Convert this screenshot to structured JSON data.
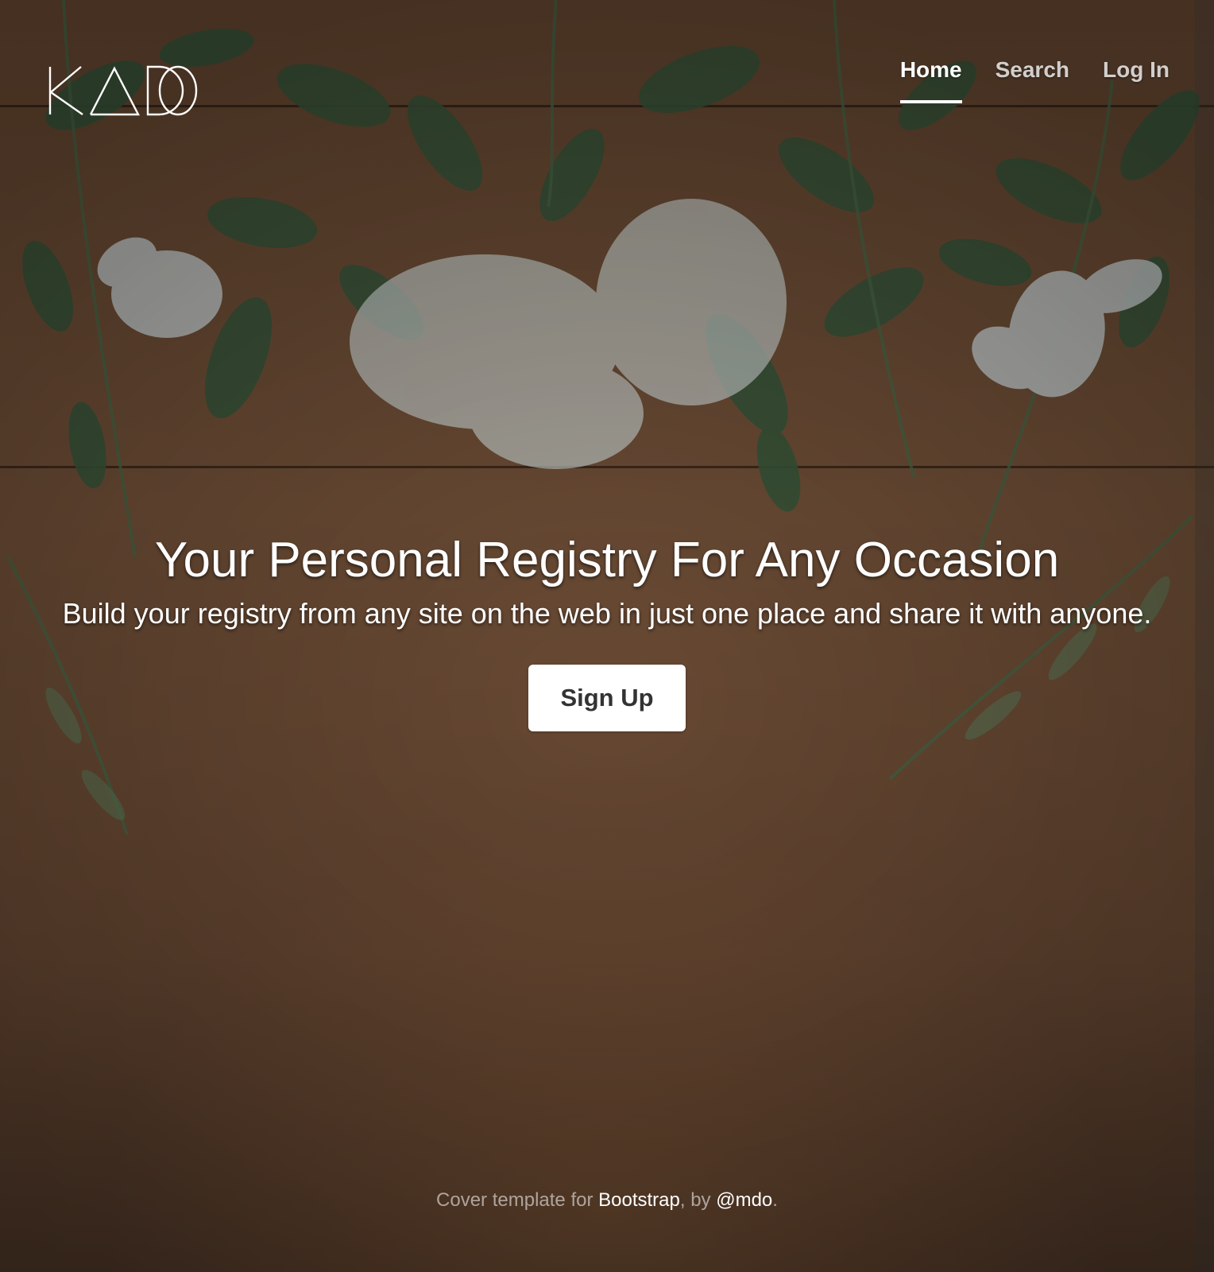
{
  "brand": {
    "logo_text": "KADO"
  },
  "nav": {
    "items": [
      {
        "label": "Home",
        "active": true
      },
      {
        "label": "Search",
        "active": false
      },
      {
        "label": "Log In",
        "active": false
      }
    ]
  },
  "hero": {
    "heading": "Your Personal Registry For Any Occasion",
    "lead": "Build your registry from any site on the web in just one place and share it with anyone.",
    "cta_label": "Sign Up"
  },
  "footer": {
    "prefix": "Cover template for ",
    "link1": "Bootstrap",
    "middle": ", by ",
    "link2": "@mdo",
    "suffix": "."
  },
  "colors": {
    "text": "#ffffff",
    "button_bg": "#ffffff",
    "button_text": "#333333",
    "leaf_green": "#3f5a3f",
    "wood": "#72513a"
  }
}
